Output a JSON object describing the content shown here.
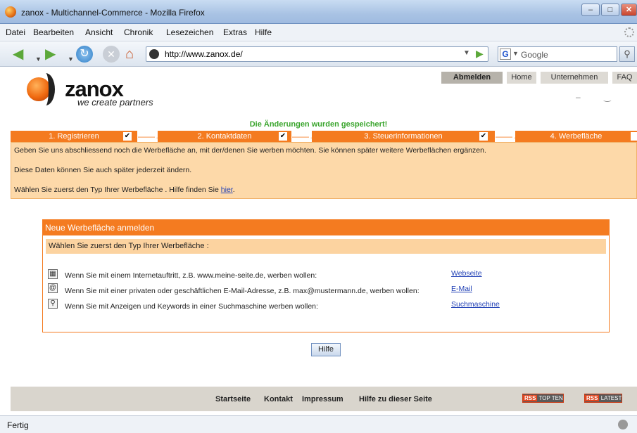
{
  "window": {
    "title": "zanox - Multichannel-Commerce - Mozilla Firefox"
  },
  "menu": [
    "Datei",
    "Bearbeiten",
    "Ansicht",
    "Chronik",
    "Lesezeichen",
    "Extras",
    "Hilfe"
  ],
  "address": {
    "url": "http://www.zanox.de/"
  },
  "search": {
    "placeholder": "Google"
  },
  "logo": {
    "word": "zanox",
    "tagline": "we create partners"
  },
  "topnav": {
    "logout": "Abmelden",
    "home": "Home",
    "company": "Unternehmen",
    "faq": "FAQ"
  },
  "saved_message": "Die Änderungen wurden gespeichert!",
  "steps": [
    {
      "label": "1. Registrieren",
      "checked": true
    },
    {
      "label": "2. Kontaktdaten",
      "checked": true
    },
    {
      "label": "3. Steuerinformationen",
      "checked": true
    },
    {
      "label": "4. Werbefläche",
      "checked": false
    }
  ],
  "info": {
    "line1": "Geben Sie uns abschliessend noch die Werbefläche an, mit der/denen Sie werben möchten. Sie können später weitere Werbeflächen ergänzen.",
    "line2": "Diese Daten können Sie auch später jederzeit ändern.",
    "line3_prefix": "Wählen Sie zuerst den Typ Ihrer Werbefläche . Hilfe finden Sie ",
    "line3_link": "hier",
    "line3_suffix": "."
  },
  "panel": {
    "title": "Neue Werbefläche anmelden",
    "subtitle": "Wählen Sie zuerst den Typ Ihrer Werbefläche :",
    "options": [
      {
        "icon": "website-icon",
        "text": "Wenn Sie mit einem Internetauftritt, z.B. www.meine-seite.de, werben wollen:",
        "link": "Webseite"
      },
      {
        "icon": "email-icon",
        "text": "Wenn Sie mit einer privaten oder geschäftlichen E-Mail-Adresse, z.B. max@mustermann.de, werben wollen:",
        "link": "E-Mail"
      },
      {
        "icon": "search-engine-icon",
        "text": "Wenn Sie mit Anzeigen und Keywords in einer Suchmaschine werben wollen:",
        "link": "Suchmaschine"
      }
    ]
  },
  "help_button": "Hilfe",
  "footer": {
    "links": [
      "Startseite",
      "Kontakt",
      "Impressum",
      "Hilfe zu dieser Seite"
    ],
    "rss1_tag": "RSS",
    "rss1_label": "TOP TEN",
    "rss2_tag": "RSS",
    "rss2_label": "LATEST"
  },
  "status": {
    "text": "Fertig"
  },
  "colors": {
    "brand_orange": "#f47b20",
    "info_bg": "#fdd9a9",
    "saved_green": "#3aa52d",
    "link_blue": "#1f3fb5"
  }
}
